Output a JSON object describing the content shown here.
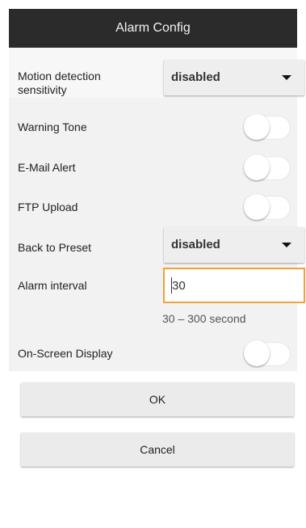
{
  "title": "Alarm Config",
  "rows": {
    "motion": {
      "label": "Motion detection sensitivity",
      "value": "disabled"
    },
    "warning_tone": {
      "label": "Warning Tone",
      "enabled": false
    },
    "email_alert": {
      "label": "E-Mail Alert",
      "enabled": false
    },
    "ftp_upload": {
      "label": "FTP Upload",
      "enabled": false
    },
    "preset": {
      "label": "Back to Preset",
      "value": "disabled"
    },
    "interval": {
      "label": "Alarm interval",
      "value": "30",
      "hint": "30 – 300 second"
    },
    "osd": {
      "label": "On-Screen Display",
      "enabled": false
    }
  },
  "buttons": {
    "ok": "OK",
    "cancel": "Cancel"
  },
  "colors": {
    "titlebar": "#2b2b2b",
    "focus_border": "#f0a13a"
  }
}
